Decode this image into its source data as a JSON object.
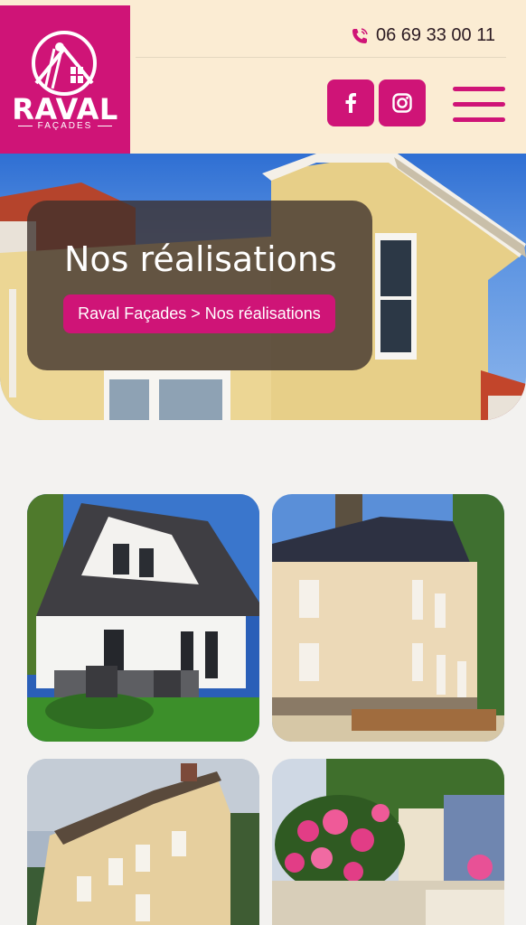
{
  "header": {
    "logo": {
      "brand": "RAVAL",
      "sub": "FAÇADES"
    },
    "phone": "06 69 33 00 11",
    "social": [
      {
        "name": "facebook",
        "icon": "facebook-icon"
      },
      {
        "name": "instagram",
        "icon": "instagram-icon"
      }
    ],
    "menu_icon": "hamburger-icon"
  },
  "hero": {
    "title": "Nos réalisations",
    "breadcrumb": "Raval Façades > Nos réalisations"
  },
  "gallery": {
    "items": [
      {
        "subject": "house-white-dormer"
      },
      {
        "subject": "manor-cream-facade"
      },
      {
        "subject": "house-three-storey"
      },
      {
        "subject": "wall-roses"
      }
    ]
  },
  "colors": {
    "brand": "#cf1477",
    "header_bg": "#fbecd3",
    "page_bg": "#f3f2f0"
  }
}
